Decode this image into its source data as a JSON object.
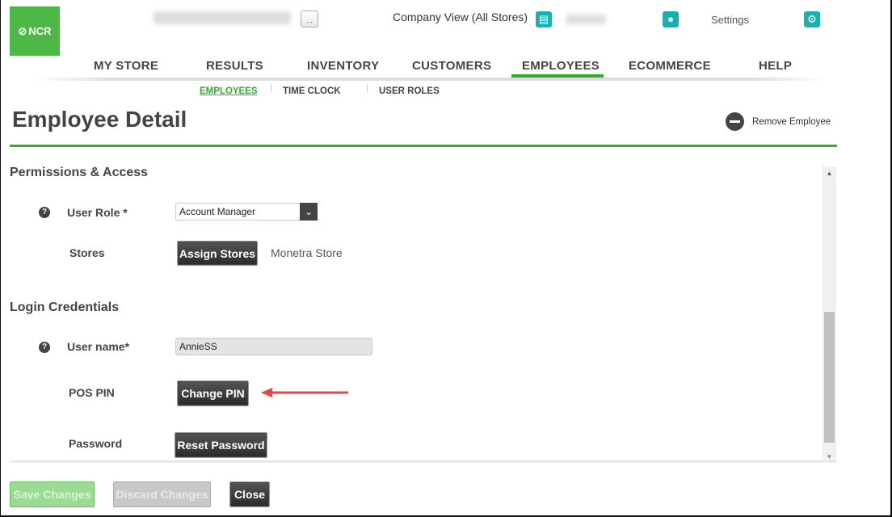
{
  "header": {
    "logo_text": "NCR",
    "more_button": "...",
    "company_view": "Company View (All Stores)",
    "settings": "Settings"
  },
  "nav": {
    "items": [
      "MY STORE",
      "RESULTS",
      "INVENTORY",
      "CUSTOMERS",
      "EMPLOYEES",
      "ECOMMERCE",
      "HELP"
    ],
    "active": "EMPLOYEES"
  },
  "subnav": {
    "items": [
      "EMPLOYEES",
      "TIME CLOCK",
      "USER ROLES"
    ],
    "active": "EMPLOYEES"
  },
  "page": {
    "title": "Employee Detail",
    "remove_employee": "Remove Employee"
  },
  "permissions": {
    "heading": "Permissions & Access",
    "user_role_label": "User Role *",
    "user_role_value": "Account Manager",
    "stores_label": "Stores",
    "assign_stores": "Assign Stores",
    "store_name": "Monetra Store"
  },
  "login": {
    "heading": "Login Credentials",
    "username_label": "User name*",
    "username_value": "AnnieSS",
    "pos_pin_label": "POS PIN",
    "change_pin": "Change PIN",
    "password_label": "Password",
    "reset_password": "Reset Password"
  },
  "footer": {
    "save": "Save Changes",
    "discard": "Discard Changes",
    "close": "Close"
  },
  "colors": {
    "accent": "#3aaa35",
    "teal": "#1ab0b0",
    "arrow": "#e84545"
  }
}
